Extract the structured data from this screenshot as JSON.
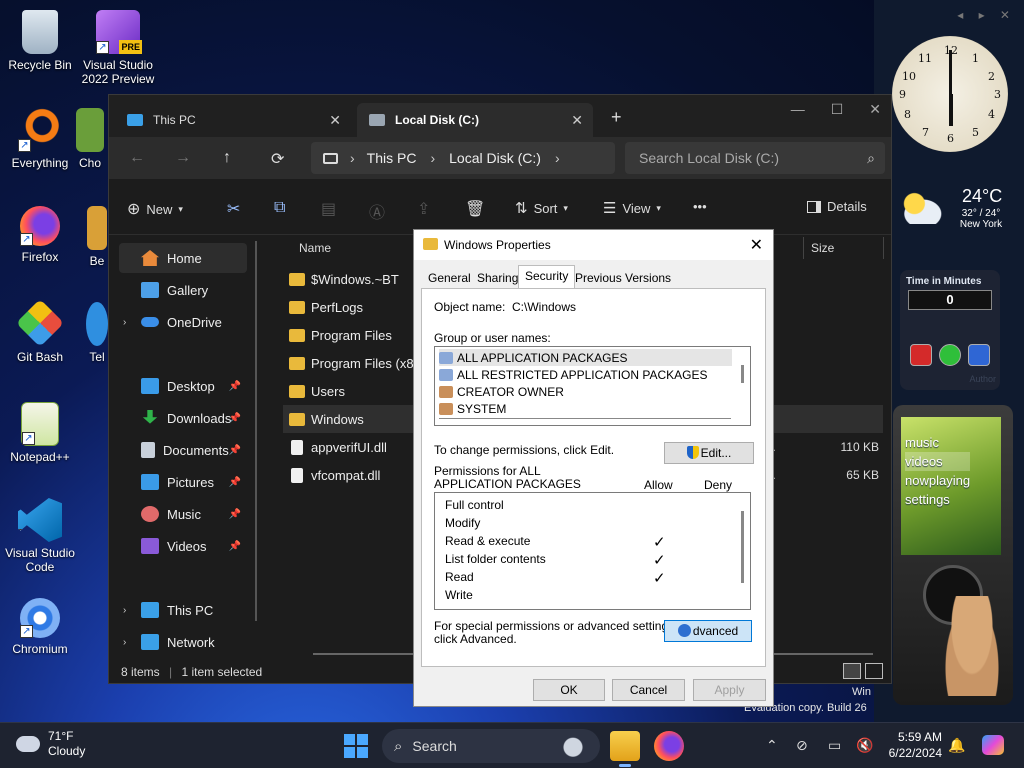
{
  "desktop": {
    "icons": [
      {
        "label": "Recycle Bin"
      },
      {
        "label": "Visual Studio 2022 Preview",
        "badge": "PRE"
      },
      {
        "label": "Everything"
      },
      {
        "label": "Cho"
      },
      {
        "label": "Firefox"
      },
      {
        "label": "Be"
      },
      {
        "label": "Git Bash"
      },
      {
        "label": "Tel"
      },
      {
        "label": "Notepad++"
      },
      {
        "label": "Visual Studio Code"
      },
      {
        "label": "Chromium"
      }
    ]
  },
  "widgets": {
    "clock_numerals": [
      "12",
      "1",
      "2",
      "3",
      "4",
      "5",
      "6",
      "7",
      "8",
      "9",
      "10",
      "11"
    ],
    "weather": {
      "temp": "24°C",
      "range": "32° / 24°",
      "city": "New York"
    },
    "timer": {
      "title": "Time in Minutes",
      "value": "0",
      "author": "Author"
    },
    "zune": {
      "menu": [
        "music",
        "videos",
        "nowplaying",
        "settings"
      ],
      "selected_index": 1
    },
    "eval_text": "Evaluation copy. Build 26",
    "win_text": "Win"
  },
  "explorer": {
    "tabs": [
      {
        "label": "This PC",
        "active": false
      },
      {
        "label": "Local Disk (C:)",
        "active": true
      }
    ],
    "new_tab": "+",
    "address": [
      "This PC",
      "Local Disk (C:)"
    ],
    "search_placeholder": "Search Local Disk (C:)",
    "commands": {
      "new": "New",
      "sort": "Sort",
      "view": "View",
      "more": "•••",
      "details": "Details"
    },
    "sidebar": [
      {
        "label": "Home",
        "selected": true
      },
      {
        "label": "Gallery"
      },
      {
        "label": "OneDrive"
      },
      {
        "label": "Desktop"
      },
      {
        "label": "Downloads"
      },
      {
        "label": "Documents"
      },
      {
        "label": "Pictures"
      },
      {
        "label": "Music"
      },
      {
        "label": "Videos"
      },
      {
        "label": "This PC"
      },
      {
        "label": "Network"
      }
    ],
    "columns": {
      "name": "Name",
      "size": "Size"
    },
    "files": [
      {
        "name": "$Windows.~BT",
        "type": "",
        "size": "",
        "kind": "folder"
      },
      {
        "name": "PerfLogs",
        "type": "",
        "size": "",
        "kind": "folder"
      },
      {
        "name": "Program Files",
        "type": "",
        "size": "",
        "kind": "folder"
      },
      {
        "name": "Program Files (x86)",
        "type": "",
        "size": "",
        "kind": "folder"
      },
      {
        "name": "Users",
        "type": "",
        "size": "",
        "kind": "folder"
      },
      {
        "name": "Windows",
        "type": "",
        "size": "",
        "kind": "folder",
        "selected": true
      },
      {
        "name": "appverifUI.dll",
        "type": "ns...",
        "size": "110 KB",
        "kind": "file"
      },
      {
        "name": "vfcompat.dll",
        "type": "ns...",
        "size": "65 KB",
        "kind": "file"
      }
    ],
    "status": {
      "count": "8 items",
      "selection": "1 item selected"
    }
  },
  "dialog": {
    "title": "Windows Properties",
    "tabs": [
      "General",
      "Sharing",
      "Security",
      "Previous Versions"
    ],
    "active_tab": "Security",
    "object_label": "Object name:",
    "object_value": "C:\\Windows",
    "group_label": "Group or user names:",
    "users": [
      "ALL APPLICATION PACKAGES",
      "ALL RESTRICTED APPLICATION PACKAGES",
      "CREATOR OWNER",
      "SYSTEM"
    ],
    "change_hint": "To change permissions, click Edit.",
    "edit_button": "Edit...",
    "perm_label_line1": "Permissions for ALL",
    "perm_label_line2": "APPLICATION PACKAGES",
    "allow_label": "Allow",
    "deny_label": "Deny",
    "permissions": [
      {
        "name": "Full control",
        "allow": ""
      },
      {
        "name": "Modify",
        "allow": ""
      },
      {
        "name": "Read & execute",
        "allow": "✓"
      },
      {
        "name": "List folder contents",
        "allow": "✓"
      },
      {
        "name": "Read",
        "allow": "✓"
      },
      {
        "name": "Write",
        "allow": ""
      }
    ],
    "special_hint_line1": "For special permissions or advanced settings,",
    "special_hint_line2": "click Advanced.",
    "advanced_button": "dvanced",
    "ok": "OK",
    "cancel": "Cancel",
    "apply": "Apply"
  },
  "taskbar": {
    "weather_temp": "71°F",
    "weather_cond": "Cloudy",
    "search_label": "Search",
    "time": "5:59 AM",
    "date": "6/22/2024"
  },
  "colors": {
    "accent": "#0078d7",
    "folder": "#e9b93b",
    "explorer_bg": "#1c1c1c"
  }
}
